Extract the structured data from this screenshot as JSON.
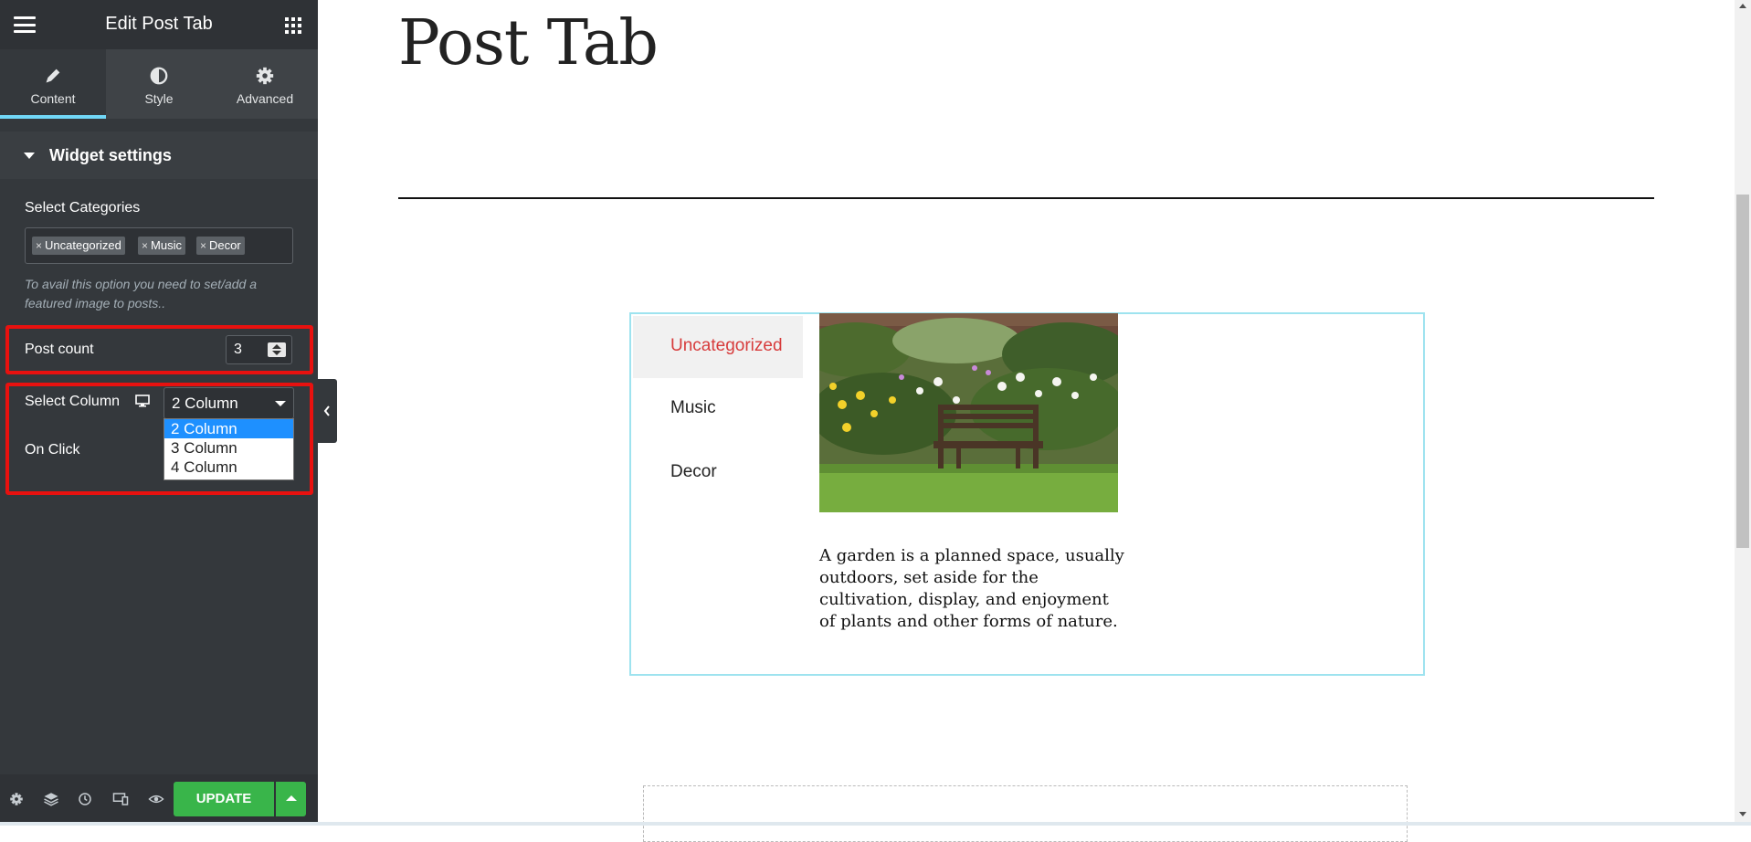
{
  "sidebar": {
    "title": "Edit Post Tab",
    "tabs": [
      {
        "label": "Content",
        "icon": "pencil-icon"
      },
      {
        "label": "Style",
        "icon": "contrast-icon"
      },
      {
        "label": "Advanced",
        "icon": "gear-icon"
      }
    ],
    "section_title": "Widget settings",
    "categories_label": "Select Categories",
    "categories": [
      "Uncategorized",
      "Music",
      "Decor"
    ],
    "hint": "To avail this option you need to set/add a featured image to posts..",
    "post_count_label": "Post count",
    "post_count_value": "3",
    "select_column_label": "Select Column",
    "select_column_value": "2 Column",
    "select_column_options": [
      "2 Column",
      "3 Column",
      "4 Column"
    ],
    "on_click_label": "On Click",
    "update_label": "UPDATE"
  },
  "canvas": {
    "page_title": "Post Tab",
    "tabs": [
      "Uncategorized",
      "Music",
      "Decor"
    ],
    "active_tab": "Uncategorized",
    "post_excerpt": "A garden is a planned space, usually outdoors, set aside for the cultivation, display, and enjoyment of plants and other forms of nature."
  },
  "colors": {
    "accent": "#71d7f7",
    "update_button": "#39b54a",
    "highlight_box": "#e8110f",
    "active_tab_text": "#d73b3b"
  }
}
